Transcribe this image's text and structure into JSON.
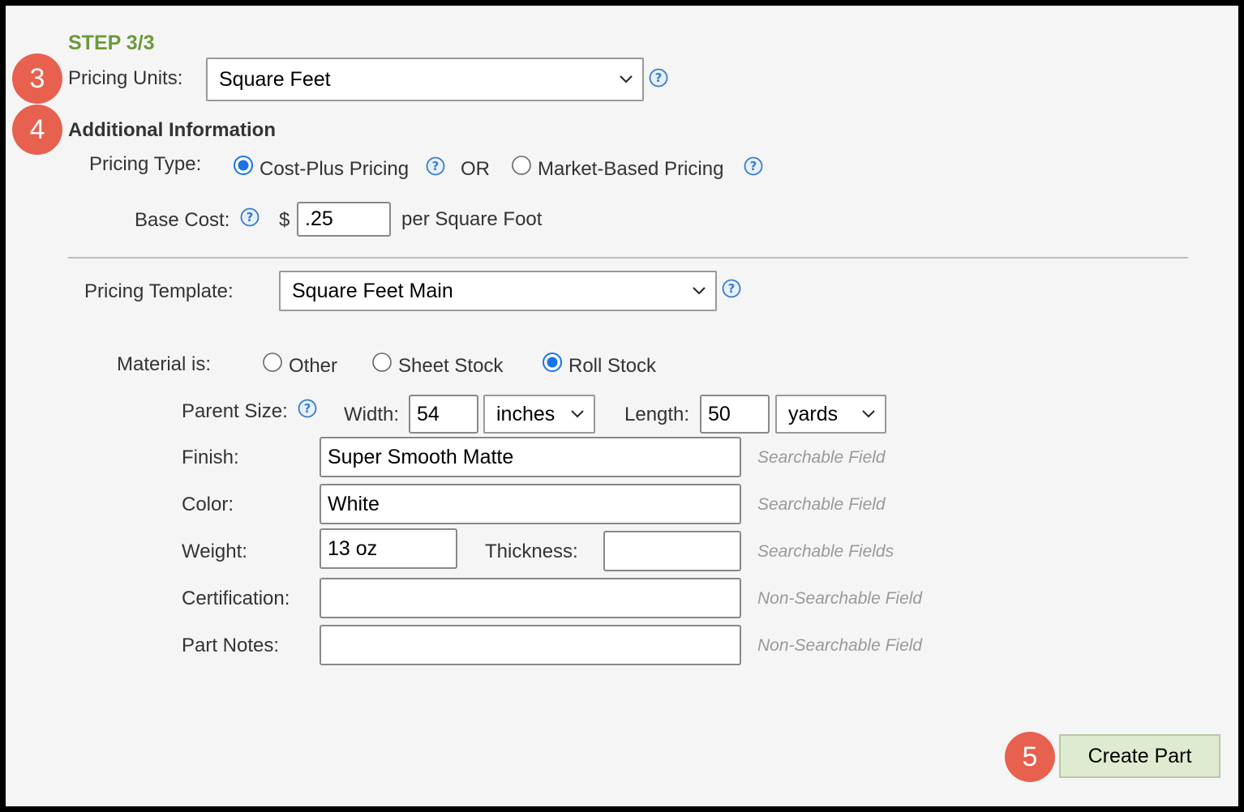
{
  "step_title": "STEP 3/3",
  "badges": {
    "b3": "3",
    "b4": "4",
    "b5": "5"
  },
  "pricing_units": {
    "label": "Pricing Units:",
    "value": "Square Feet"
  },
  "additional_info": {
    "heading": "Additional Information"
  },
  "pricing_type": {
    "label": "Pricing Type:",
    "option_cost_plus": "Cost-Plus Pricing",
    "or_text": "OR",
    "option_market": "Market-Based Pricing",
    "selected": "Cost-Plus Pricing"
  },
  "base_cost": {
    "label": "Base Cost:",
    "currency": "$",
    "value": ".25",
    "unit_text": "per Square Foot"
  },
  "pricing_template": {
    "label": "Pricing Template:",
    "value": "Square Feet Main"
  },
  "material": {
    "label": "Material is:",
    "options": [
      "Other",
      "Sheet Stock",
      "Roll Stock"
    ],
    "selected": "Roll Stock"
  },
  "parent_size": {
    "label": "Parent Size:",
    "width_label": "Width:",
    "width_value": "54",
    "width_unit": "inches",
    "length_label": "Length:",
    "length_value": "50",
    "length_unit": "yards"
  },
  "fields": {
    "finish": {
      "label": "Finish:",
      "value": "Super Smooth Matte",
      "hint": "Searchable Field"
    },
    "color": {
      "label": "Color:",
      "value": "White",
      "hint": "Searchable Field"
    },
    "weight": {
      "label": "Weight:",
      "value": "13 oz",
      "thickness_label": "Thickness:",
      "thickness_value": "",
      "hint": "Searchable Fields"
    },
    "certification": {
      "label": "Certification:",
      "value": "",
      "hint": "Non-Searchable Field"
    },
    "part_notes": {
      "label": "Part Notes:",
      "value": "",
      "hint": "Non-Searchable Field"
    }
  },
  "create_button": "Create Part",
  "colors": {
    "step_green": "#6a9a3a",
    "badge_red": "#e8604e",
    "radio_blue": "#1a73e8",
    "button_bg": "#dfebd0"
  }
}
